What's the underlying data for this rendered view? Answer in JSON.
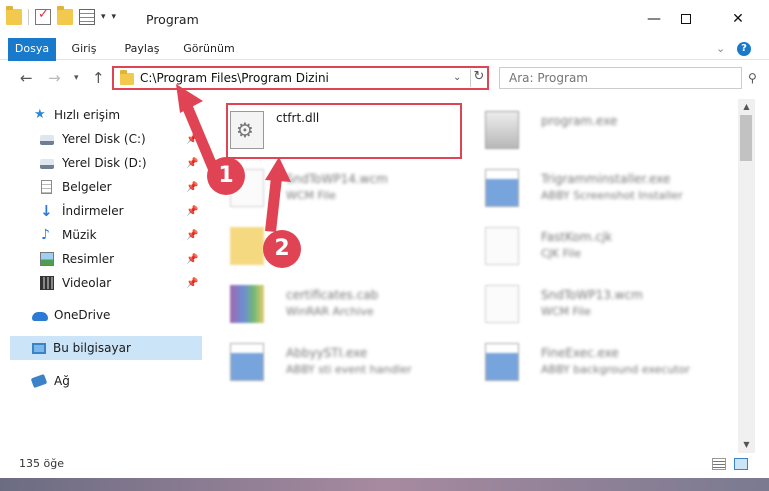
{
  "window": {
    "title": "Program"
  },
  "ribbon": {
    "tabs": [
      "Dosya",
      "Giriş",
      "Paylaş",
      "Görünüm"
    ]
  },
  "address": {
    "path": "C:\\Program Files\\Program Dizini"
  },
  "search": {
    "placeholder": "Ara: Program"
  },
  "sidebar": {
    "quick_access": "Hızlı erişim",
    "items": [
      {
        "label": "Yerel Disk (C:)",
        "icon": "disk-icon"
      },
      {
        "label": "Yerel Disk (D:)",
        "icon": "disk-icon"
      },
      {
        "label": "Belgeler",
        "icon": "documents-icon"
      },
      {
        "label": "İndirmeler",
        "icon": "download-icon"
      },
      {
        "label": "Müzik",
        "icon": "music-icon"
      },
      {
        "label": "Resimler",
        "icon": "pictures-icon"
      },
      {
        "label": "Videolar",
        "icon": "video-icon"
      }
    ],
    "onedrive": "OneDrive",
    "this_pc": "Bu bilgisayar",
    "network": "Ağ"
  },
  "files": [
    {
      "name": "ctfrt.dll",
      "type": ""
    },
    {
      "name": "program.exe",
      "type": ""
    },
    {
      "name": "SndToWP14.wcm",
      "type": "WCM File"
    },
    {
      "name": "Trigramminstaller.exe",
      "type": "ABBY Screenshot Installer"
    },
    {
      "name": "",
      "type": ""
    },
    {
      "name": "FastKom.cjk",
      "type": "CJK File"
    },
    {
      "name": "certificates.cab",
      "type": "WinRAR Archive"
    },
    {
      "name": "SndToWP13.wcm",
      "type": "WCM File"
    },
    {
      "name": "AbbyySTI.exe",
      "type": "ABBY sti event handler"
    },
    {
      "name": "FineExec.exe",
      "type": "ABBY background executor"
    }
  ],
  "status": {
    "count": "135 öğe"
  },
  "annotations": {
    "badge1": "1",
    "badge2": "2",
    "color": "#e04353"
  }
}
